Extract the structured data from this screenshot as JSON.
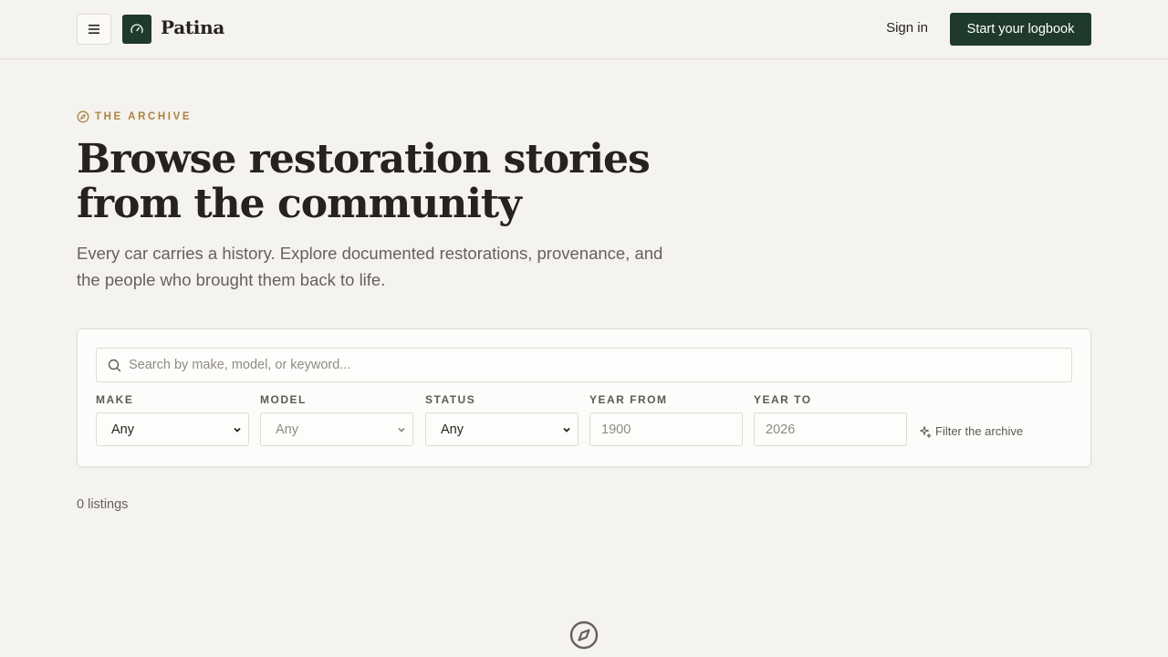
{
  "header": {
    "brand": "Patina",
    "sign_in": "Sign in",
    "cta": "Start your logbook",
    "menu_icon": "hamburger-menu-icon",
    "logo_icon": "speedometer-icon",
    "accent_color": "#1f3a2b"
  },
  "hero": {
    "eyebrow": "THE ARCHIVE",
    "eyebrow_icon": "compass-icon",
    "eyebrow_color": "#a98442",
    "title_line1": "Browse restoration stories",
    "title_line2": "from the community",
    "subtitle": "Every car carries a history. Explore documented restorations, provenance, and the people who brought them back to life."
  },
  "filters": {
    "search_placeholder": "Search by make, model, or keyword...",
    "make": {
      "label": "MAKE",
      "value": "Any"
    },
    "model": {
      "label": "MODEL",
      "value": "Any"
    },
    "status": {
      "label": "STATUS",
      "value": "Any"
    },
    "year_from": {
      "label": "YEAR FROM",
      "placeholder": "1900"
    },
    "year_to": {
      "label": "YEAR TO",
      "placeholder": "2026"
    },
    "hint": "Filter the archive",
    "hint_icon": "sparkles-icon"
  },
  "results": {
    "count_text": "0 listings",
    "empty_icon": "compass-icon"
  }
}
